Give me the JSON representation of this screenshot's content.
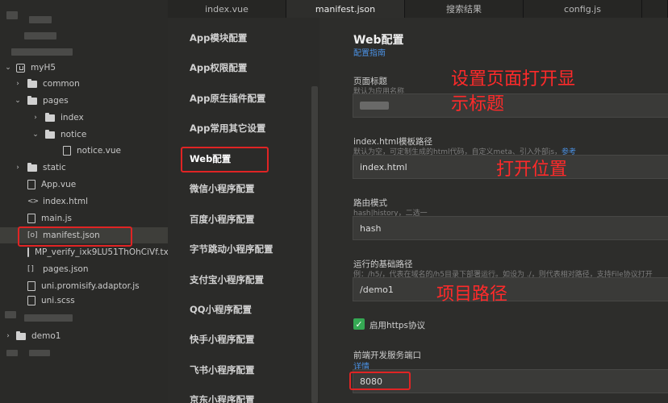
{
  "tabs": [
    "index.vue",
    "manifest.json",
    "搜索结果",
    "config.js"
  ],
  "tree": {
    "project": "myH5",
    "items": [
      {
        "label": "common",
        "icon": "folder-icon"
      },
      {
        "label": "pages",
        "icon": "folder-icon"
      },
      {
        "label": "index",
        "icon": "folder-icon"
      },
      {
        "label": "notice",
        "icon": "folder-icon"
      },
      {
        "label": "notice.vue",
        "icon": "file-icon"
      },
      {
        "label": "static",
        "icon": "folder-icon"
      },
      {
        "label": "App.vue",
        "icon": "file-icon"
      },
      {
        "label": "index.html",
        "icon": "code-icon"
      },
      {
        "label": "main.js",
        "icon": "file-icon"
      },
      {
        "label": "manifest.json",
        "icon": "json-file-icon"
      },
      {
        "label": "MP_verify_ixk9LU51ThOhCiVf.txt",
        "icon": "file-icon"
      },
      {
        "label": "pages.json",
        "icon": "brackets-icon"
      },
      {
        "label": "uni.promisify.adaptor.js",
        "icon": "file-icon"
      },
      {
        "label": "uni.scss",
        "icon": "file-icon"
      }
    ],
    "project2": "demo1"
  },
  "nav": {
    "items": [
      "App模块配置",
      "App权限配置",
      "App原生插件配置",
      "App常用其它设置",
      "Web配置",
      "微信小程序配置",
      "百度小程序配置",
      "字节跳动小程序配置",
      "支付宝小程序配置",
      "QQ小程序配置",
      "快手小程序配置",
      "飞书小程序配置",
      "京东小程序配置"
    ]
  },
  "content": {
    "heading": "Web配置",
    "guide_link": "配置指南",
    "title_field": {
      "label": "页面标题",
      "hint": "默认为应用名称"
    },
    "template_field": {
      "label": "index.html模板路径",
      "hint": "默认为空，可定制生成的html代码，自定义meta、引入外部js，",
      "hint_link": "参考",
      "value": "index.html"
    },
    "router_field": {
      "label": "路由模式",
      "hint": "hash|history，二选一",
      "value": "hash"
    },
    "base_field": {
      "label": "运行的基础路径",
      "hint": "例：/h5/，代表在域名的/h5目录下部署运行。如设为 ./，则代表相对路径，支持File协议打开",
      "value": "/demo1"
    },
    "https": {
      "label": "启用https协议",
      "checked": true
    },
    "port_field": {
      "label": "前端开发服务端口",
      "link": "详情",
      "value": "8080"
    }
  },
  "annotations": {
    "title_note_line1": "设置页面打开显",
    "title_note_line2": "示标题",
    "template_note": "打开位置",
    "base_note": "项目路径"
  },
  "colors": {
    "annotation": "#e02424",
    "link": "#4a90e2",
    "checkbox": "#35a853"
  }
}
